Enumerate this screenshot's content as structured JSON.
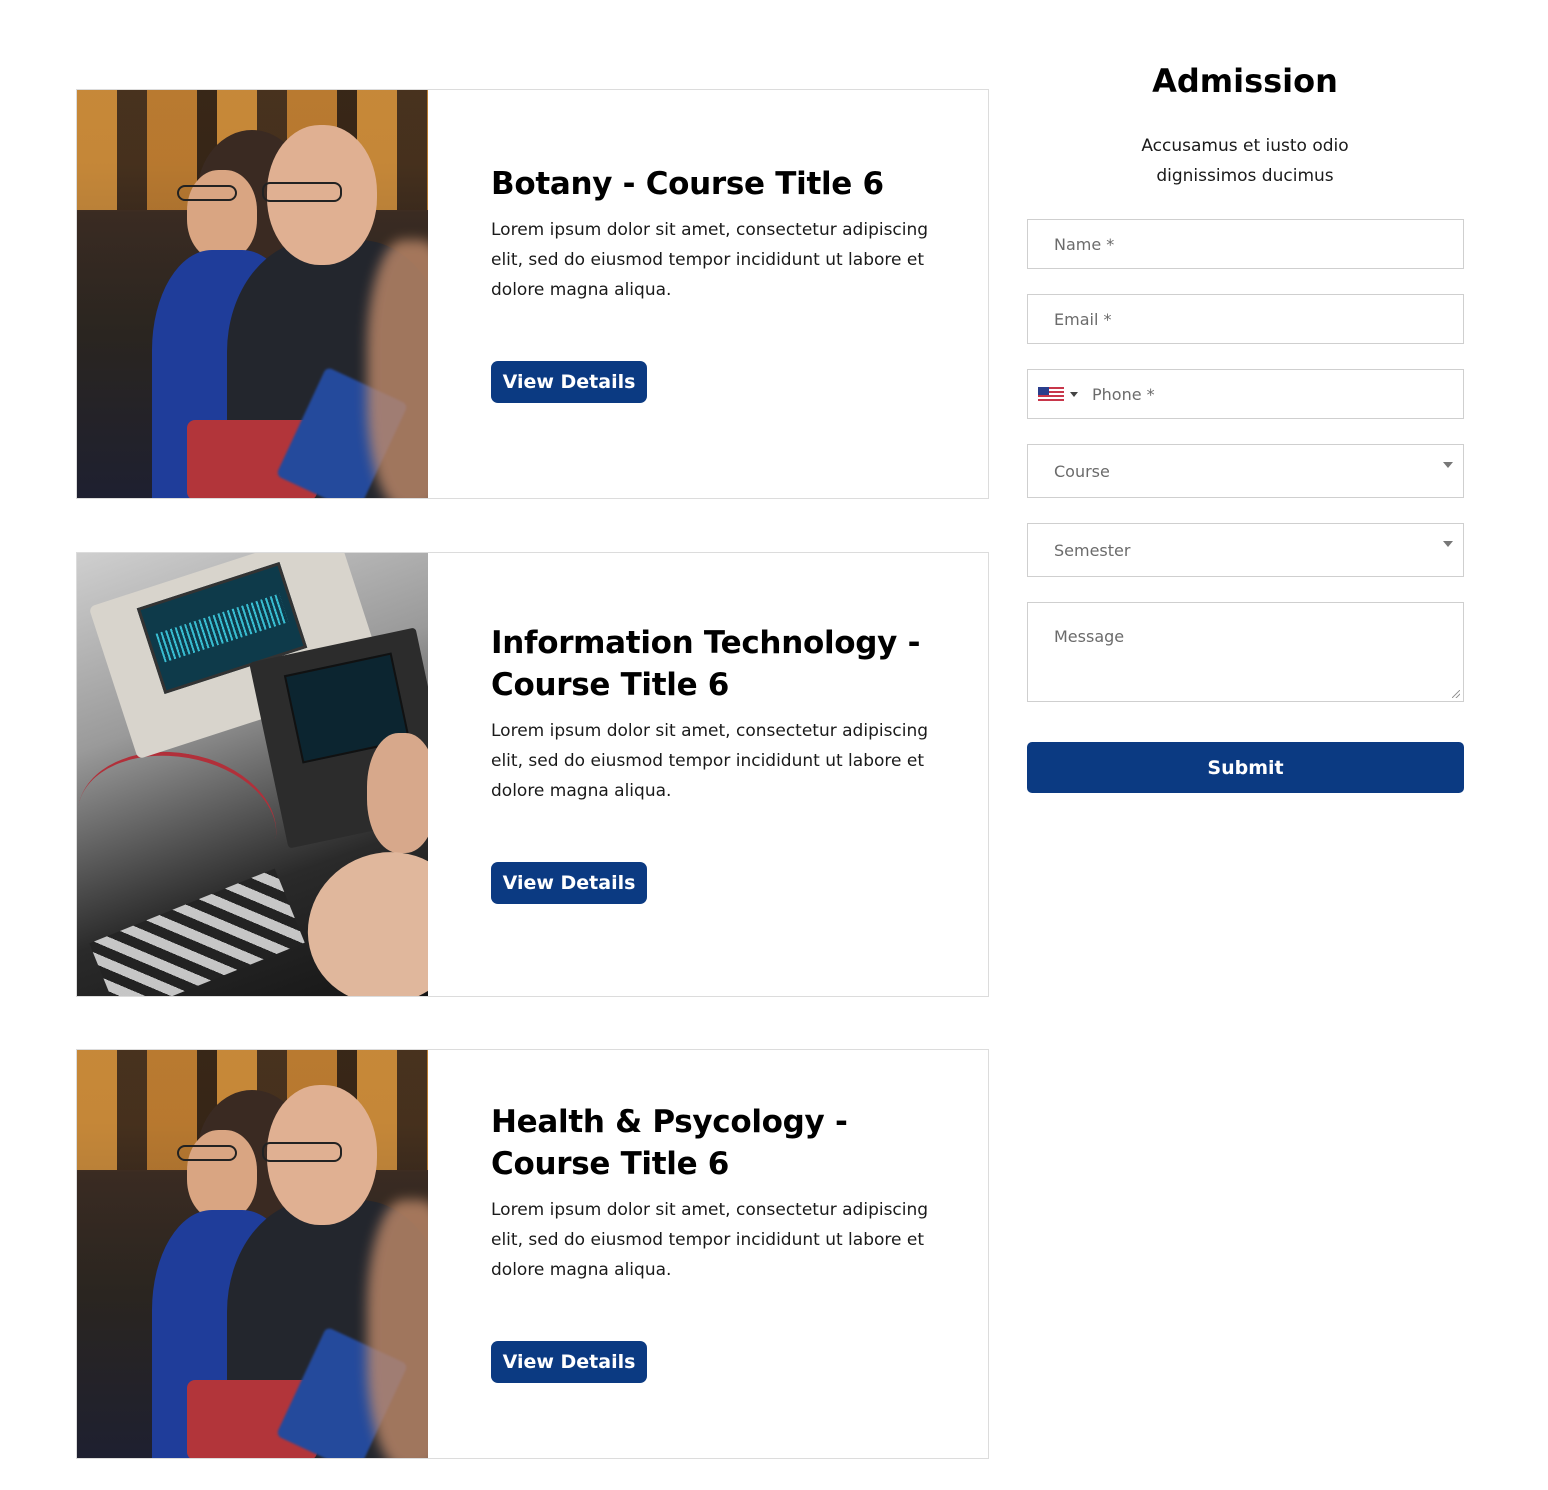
{
  "courses": [
    {
      "title": "Botany - Course Title 6",
      "description": "Lorem ipsum dolor sit amet, consectetur adipiscing elit, sed do eiusmod tempor incididunt ut labore et dolore magna aliqua.",
      "button_label": "View Details",
      "image": "seminar-audience-photo"
    },
    {
      "title": "Information Technology - Course Title 6",
      "description": "Lorem ipsum dolor sit amet, consectetur adipiscing elit, sed do eiusmod tempor incididunt ut labore et dolore magna aliqua.",
      "button_label": "View Details",
      "image": "electronics-lab-photo"
    },
    {
      "title": "Health & Psycology - Course Title 6",
      "description": "Lorem ipsum dolor sit amet, consectetur adipiscing elit, sed do eiusmod tempor incididunt ut labore et dolore magna aliqua.",
      "button_label": "View Details",
      "image": "seminar-audience-photo"
    }
  ],
  "admission": {
    "title": "Admission",
    "subtitle_line1": "Accusamus et iusto odio",
    "subtitle_line2": "dignissimos ducimus",
    "fields": {
      "name_placeholder": "Name *",
      "email_placeholder": "Email *",
      "phone_placeholder": "Phone *",
      "phone_country_icon": "us-flag-icon",
      "course_placeholder": "Course",
      "semester_placeholder": "Semester",
      "message_placeholder": "Message"
    },
    "submit_label": "Submit"
  },
  "colors": {
    "primary": "#0b3a82",
    "card_border": "#dcdcdc",
    "field_border": "#cfcfcf"
  }
}
